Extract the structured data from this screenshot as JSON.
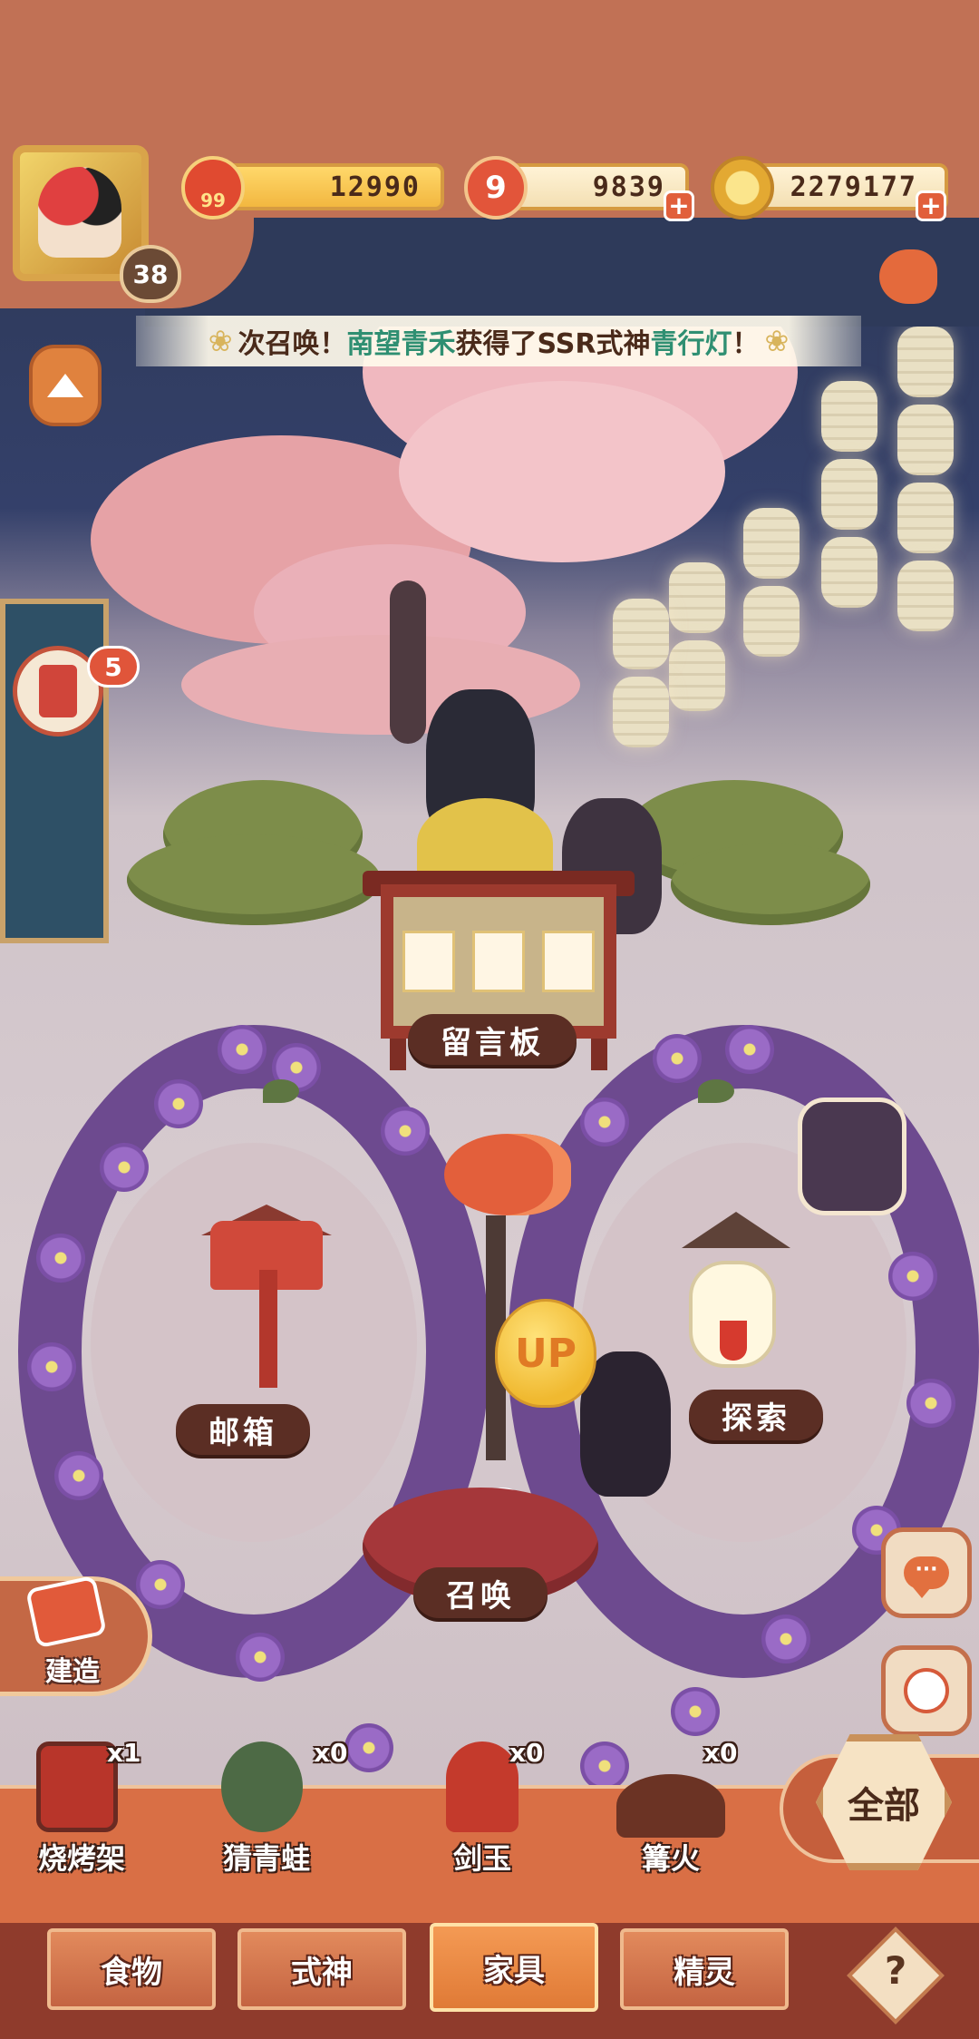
{
  "hud": {
    "player_level": "38",
    "vip_level": "99",
    "jade": "12990",
    "stamina_icon_number": "9",
    "stamina": "9839",
    "gold": "2279177",
    "plus_symbol": "+"
  },
  "news": {
    "prefix": "次召唤！",
    "player": "南望青禾",
    "middle": "获得了SSR式神",
    "shikigami": "青行灯",
    "suffix": "！",
    "flower_glyph": "❀"
  },
  "notification": {
    "count": "5"
  },
  "scene_labels": {
    "board": "留言板",
    "mailbox": "邮箱",
    "explore": "探索",
    "summon": "召唤",
    "balloon": "UP"
  },
  "build": {
    "label": "建造"
  },
  "furniture_items": [
    {
      "name": "烧烤架",
      "count": "x1",
      "color": "#b8352a"
    },
    {
      "name": "猜青蛙",
      "count": "x0",
      "color": "#4d6a45"
    },
    {
      "name": "剑玉",
      "count": "x0",
      "color": "#c43a2c"
    },
    {
      "name": "篝火",
      "count": "x0",
      "color": "#6b3324"
    }
  ],
  "all_button": {
    "label": "全部"
  },
  "tabs": [
    {
      "label": "食物",
      "active": false
    },
    {
      "label": "式神",
      "active": false
    },
    {
      "label": "家具",
      "active": true
    },
    {
      "label": "精灵",
      "active": false
    }
  ],
  "help": {
    "label": "?"
  },
  "icons": {
    "side_lantern": "up-arrow-icon",
    "chat": "chat-icon",
    "spirit": "spirit-icon",
    "fish": "fish-icon"
  },
  "colors": {
    "hud_bg": "#c17155",
    "tab_bar": "#8f3b2c",
    "accent": "#e15f3b",
    "news_highlight": "#2f8f72"
  }
}
